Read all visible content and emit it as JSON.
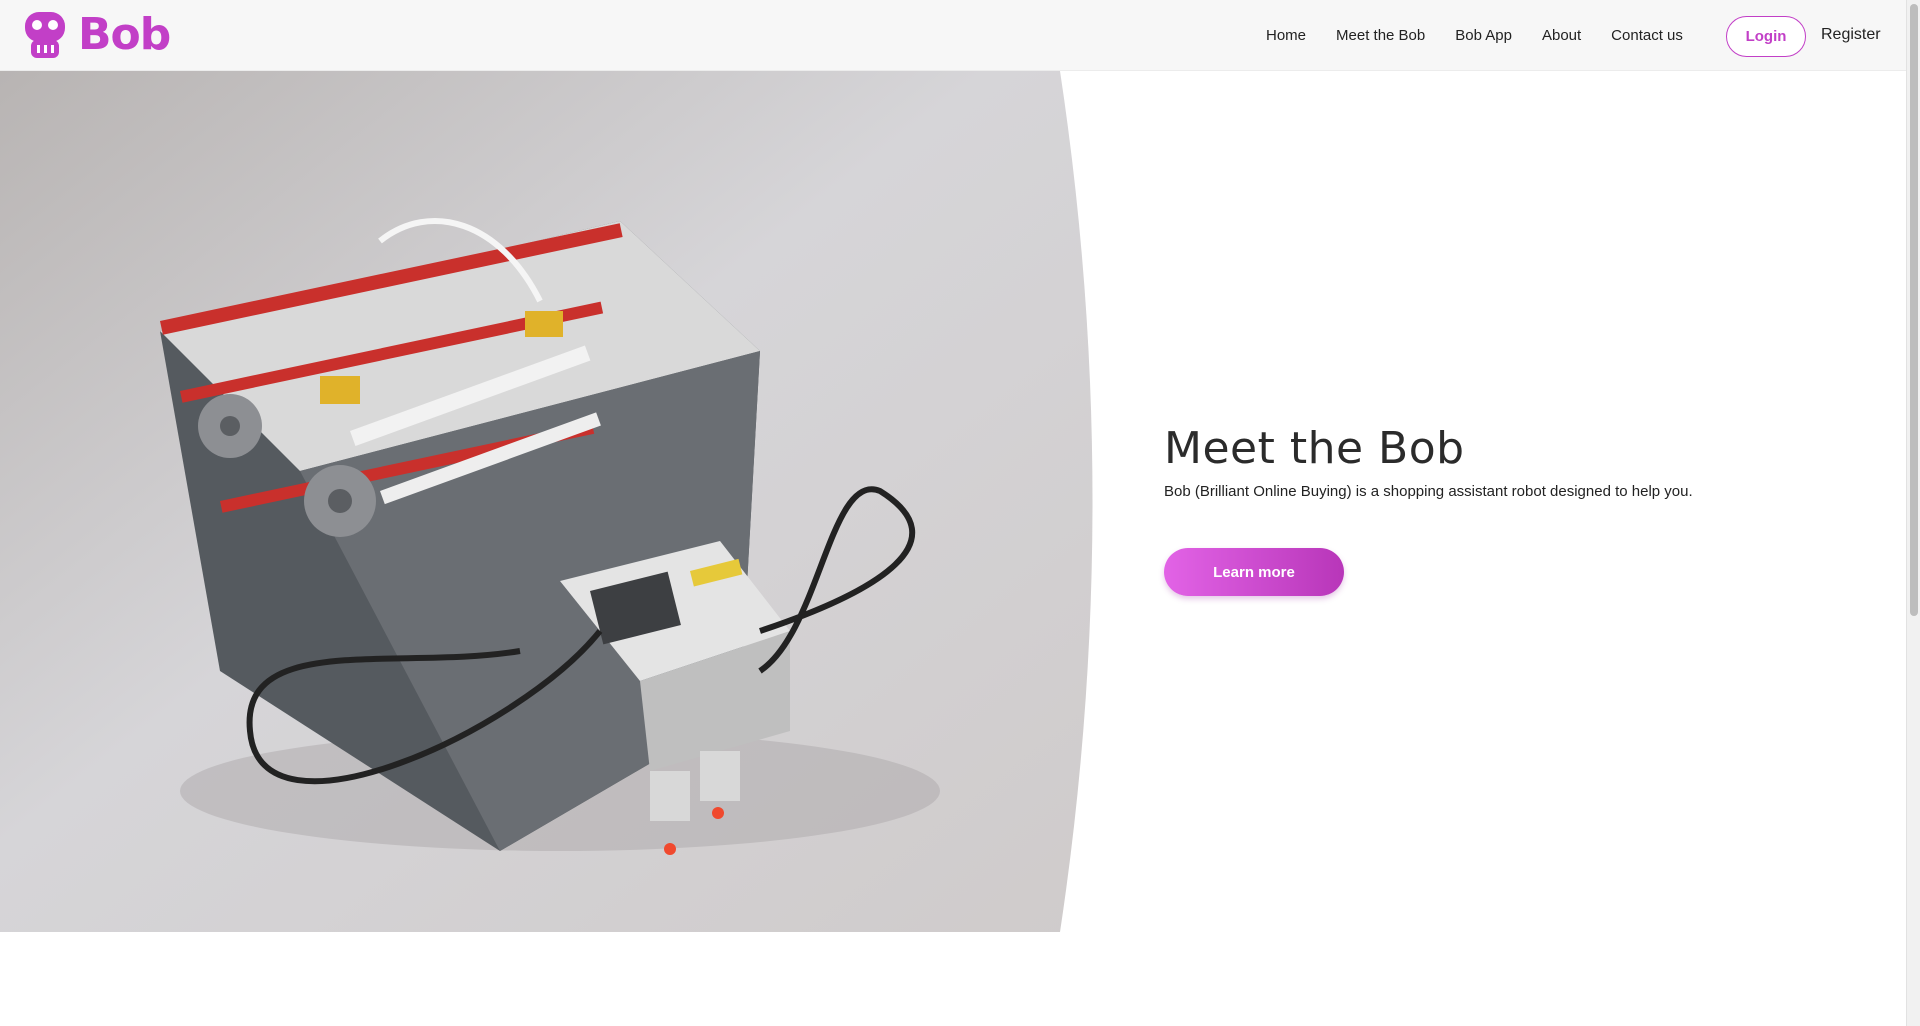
{
  "header": {
    "brand_name": "Bob",
    "nav": [
      {
        "label": "Home"
      },
      {
        "label": "Meet the Bob"
      },
      {
        "label": "Bob App"
      },
      {
        "label": "About"
      },
      {
        "label": "Contact us"
      }
    ],
    "login_label": "Login",
    "register_label": "Register"
  },
  "hero": {
    "title": "Meet the Bob",
    "description": "Bob (Brilliant Online Buying) is a shopping assistant robot designed to help you.",
    "button_label": "Learn more",
    "image_subject": "LEGO Mindstorms robot photo"
  },
  "colors": {
    "accent": "#c23fc7",
    "button_start": "#e263e6",
    "button_end": "#b836b9",
    "header_bg": "#f7f7f7"
  },
  "icons": {
    "brand_logo": "robot-head-icon"
  }
}
